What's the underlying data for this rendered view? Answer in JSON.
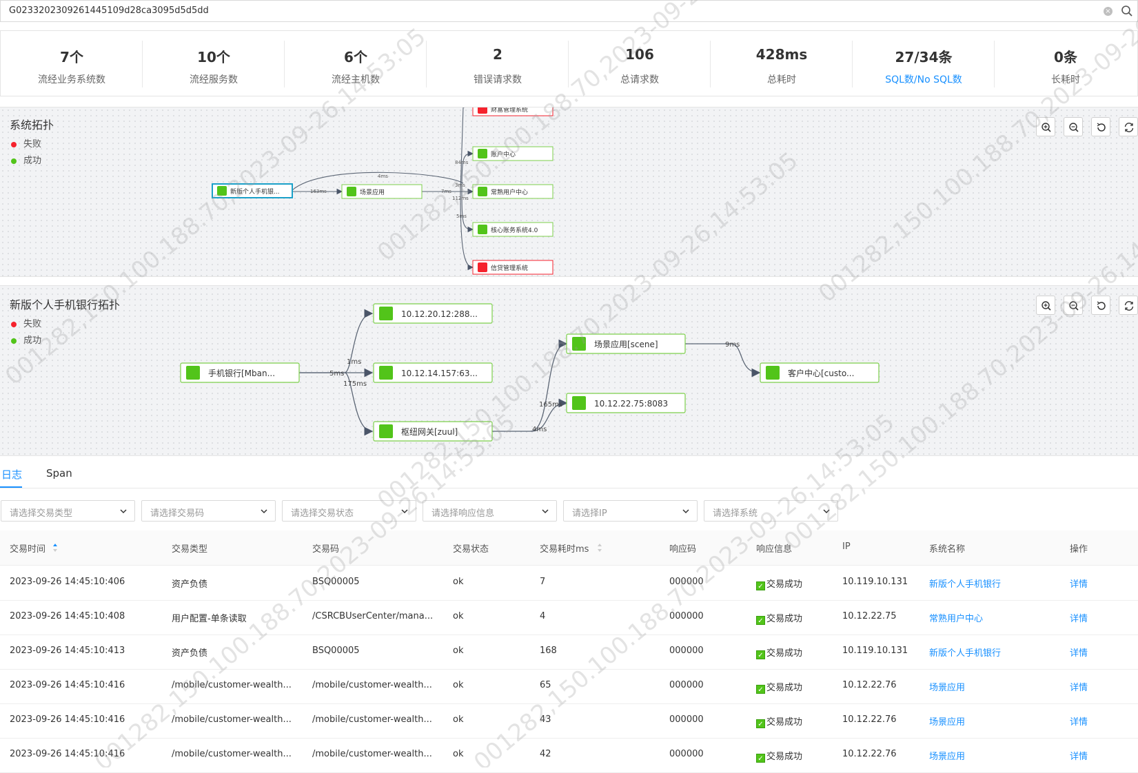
{
  "trace": {
    "id": "G0233202309261445109d28ca3095d5d5dd"
  },
  "stats": [
    {
      "value": "7个",
      "label": "流经业务系统数",
      "link": false
    },
    {
      "value": "10个",
      "label": "流经服务数",
      "link": false
    },
    {
      "value": "6个",
      "label": "流经主机数",
      "link": false
    },
    {
      "value": "2",
      "label": "错误请求数",
      "link": false
    },
    {
      "value": "106",
      "label": "总请求数",
      "link": false
    },
    {
      "value": "428ms",
      "label": "总耗时",
      "link": false
    },
    {
      "value": "27/34条",
      "label": "SQL数/No SQL数",
      "link": true
    },
    {
      "value": "0条",
      "label": "长耗时",
      "link": false
    }
  ],
  "legend": {
    "fail": "失败",
    "success": "成功"
  },
  "colors": {
    "success": "#52c41a",
    "fail": "#f5222d",
    "link": "#1890ff",
    "selected": "#1aa0c8"
  },
  "topology1": {
    "title": "系统拓扑",
    "nodes": [
      {
        "label": "新版个人手机银...",
        "status": "success",
        "selected": true
      },
      {
        "label": "场景应用",
        "status": "success"
      },
      {
        "label": "财富管理系统",
        "status": "fail"
      },
      {
        "label": "账户中心",
        "status": "success"
      },
      {
        "label": "常熟用户中心",
        "status": "success"
      },
      {
        "label": "核心账务系统4.0",
        "status": "success"
      },
      {
        "label": "信贷管理系统",
        "status": "fail"
      }
    ],
    "edges": [
      {
        "label": "163ms"
      },
      {
        "label": "4ms"
      },
      {
        "label": "84ms"
      },
      {
        "label": "3ms"
      },
      {
        "label": "112ms"
      },
      {
        "label": "5ms"
      },
      {
        "label": "7ms"
      }
    ]
  },
  "topology2": {
    "title": "新版个人手机银行拓扑",
    "nodes": [
      {
        "label": "手机银行[Mban...",
        "status": "success"
      },
      {
        "label": "10.12.20.12:288...",
        "status": "success"
      },
      {
        "label": "10.12.14.157:63...",
        "status": "success"
      },
      {
        "label": "枢纽网关[zuul]",
        "status": "success"
      },
      {
        "label": "场景应用[scene]",
        "status": "success"
      },
      {
        "label": "10.12.22.75:8083",
        "status": "success"
      },
      {
        "label": "客户中心[custo...",
        "status": "success"
      }
    ],
    "edges": [
      {
        "label": "1ms"
      },
      {
        "label": "5ms"
      },
      {
        "label": "175ms"
      },
      {
        "label": "4ms"
      },
      {
        "label": "165ms"
      },
      {
        "label": "9ms"
      }
    ]
  },
  "tabs": [
    {
      "label": "日志",
      "active": true
    },
    {
      "label": "Span",
      "active": false
    }
  ],
  "filters": [
    {
      "placeholder": "请选择交易类型"
    },
    {
      "placeholder": "请选择交易码"
    },
    {
      "placeholder": "请选择交易状态"
    },
    {
      "placeholder": "请选择响应信息"
    },
    {
      "placeholder": "请选择IP"
    },
    {
      "placeholder": "请选择系统"
    }
  ],
  "table": {
    "columns": [
      "交易时间",
      "交易类型",
      "交易码",
      "交易状态",
      "交易耗时ms",
      "响应码",
      "响应信息",
      "IP",
      "系统名称",
      "操作"
    ],
    "rows": [
      [
        "2023-09-26 14:45:10:406",
        "资产负债",
        "BSQ00005",
        "ok",
        "7",
        "000000",
        "交易成功",
        "10.119.10.131",
        "新版个人手机银行",
        "详情"
      ],
      [
        "2023-09-26 14:45:10:408",
        "用户配置-单条读取",
        "/CSRCBUserCenter/mana...",
        "ok",
        "4",
        "000000",
        "交易成功",
        "10.12.22.75",
        "常熟用户中心",
        "详情"
      ],
      [
        "2023-09-26 14:45:10:413",
        "资产负债",
        "BSQ00005",
        "ok",
        "168",
        "000000",
        "交易成功",
        "10.119.10.131",
        "新版个人手机银行",
        "详情"
      ],
      [
        "2023-09-26 14:45:10:416",
        "/mobile/customer-wealth...",
        "/mobile/customer-wealth...",
        "ok",
        "65",
        "000000",
        "交易成功",
        "10.12.22.76",
        "场景应用",
        "详情"
      ],
      [
        "2023-09-26 14:45:10:416",
        "/mobile/customer-wealth...",
        "/mobile/customer-wealth...",
        "ok",
        "43",
        "000000",
        "交易成功",
        "10.12.22.76",
        "场景应用",
        "详情"
      ],
      [
        "2023-09-26 14:45:10:416",
        "/mobile/customer-wealth...",
        "/mobile/customer-wealth...",
        "ok",
        "42",
        "000000",
        "交易成功",
        "10.12.22.76",
        "场景应用",
        "详情"
      ]
    ]
  },
  "watermark": {
    "text": "001282,150.100.188.70,2023-09-26,14:53:05"
  }
}
